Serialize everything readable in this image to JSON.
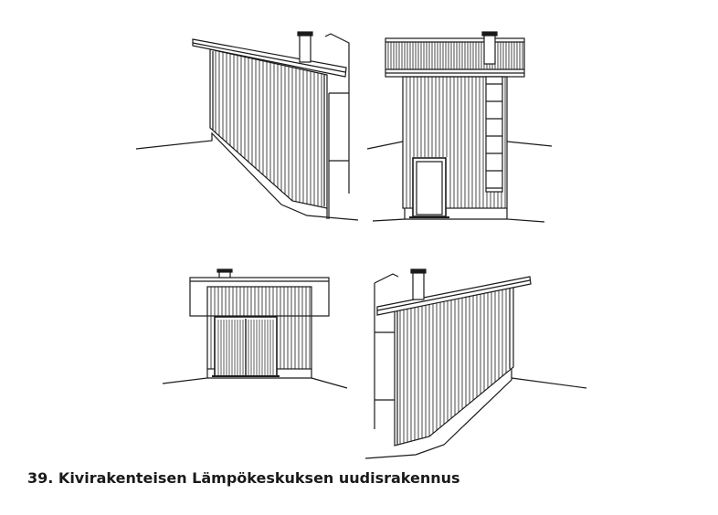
{
  "caption": "39. Kivirakenteisen Lämpökeskuksen uudisrakennus",
  "colors": {
    "ink": "#1a1a1a",
    "paper": "#ffffff"
  },
  "views": [
    {
      "id": "side-left",
      "name": "side-elevation-left"
    },
    {
      "id": "front-door",
      "name": "front-elevation-door"
    },
    {
      "id": "rear-double-door",
      "name": "rear-elevation-double-door"
    },
    {
      "id": "side-right",
      "name": "side-elevation-right"
    }
  ]
}
